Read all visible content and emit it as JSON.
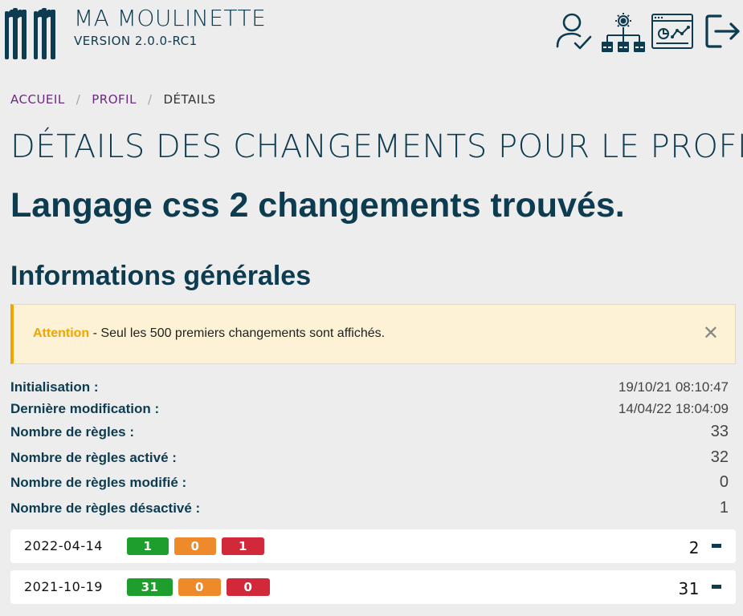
{
  "app": {
    "name": "MA MOULINETTE",
    "version": "VERSION 2.0.0-RC1"
  },
  "header_icons": [
    "user-check-icon",
    "sitemap-gear-icon",
    "dashboard-chart-icon",
    "logout-icon"
  ],
  "breadcrumb": {
    "home": "ACCUEIL",
    "profile": "PROFIL",
    "current": "DÉTAILS",
    "separator": "/"
  },
  "page": {
    "title": "DÉTAILS DES CHANGEMENTS POUR LE PROFIL.",
    "subtitle": "Langage css 2 changements trouvés.",
    "section_title": "Informations générales"
  },
  "alert": {
    "label": "Attention",
    "message": " - Seul les 500 premiers changements sont affichés.",
    "close": "✕"
  },
  "info": {
    "initialisation": {
      "label": "Initialisation :",
      "value": "19/10/21 08:10:47"
    },
    "last_modified": {
      "label": "Dernière modification :",
      "value": "14/04/22 18:04:09"
    },
    "rules_count": {
      "label": "Nombre de règles :",
      "value": "33"
    },
    "rules_active": {
      "label": "Nombre de règles activé :",
      "value": "32"
    },
    "rules_modified": {
      "label": "Nombre de règles modifié :",
      "value": "0"
    },
    "rules_disabled": {
      "label": "Nombre de règles désactivé :",
      "value": "1"
    }
  },
  "history": [
    {
      "date": "2022-04-14",
      "added": "1",
      "modified": "0",
      "removed": "1",
      "total": "2"
    },
    {
      "date": "2021-10-19",
      "added": "31",
      "modified": "0",
      "removed": "0",
      "total": "31"
    }
  ],
  "colors": {
    "primary": "#0d3b4f",
    "link": "#6a2a7e",
    "warning": "#f0a500",
    "warning_bg": "#fdf1d6",
    "badge_green": "#1e9e2c",
    "badge_orange": "#ef8a2a",
    "badge_red": "#d1283a",
    "background": "#ededed"
  }
}
